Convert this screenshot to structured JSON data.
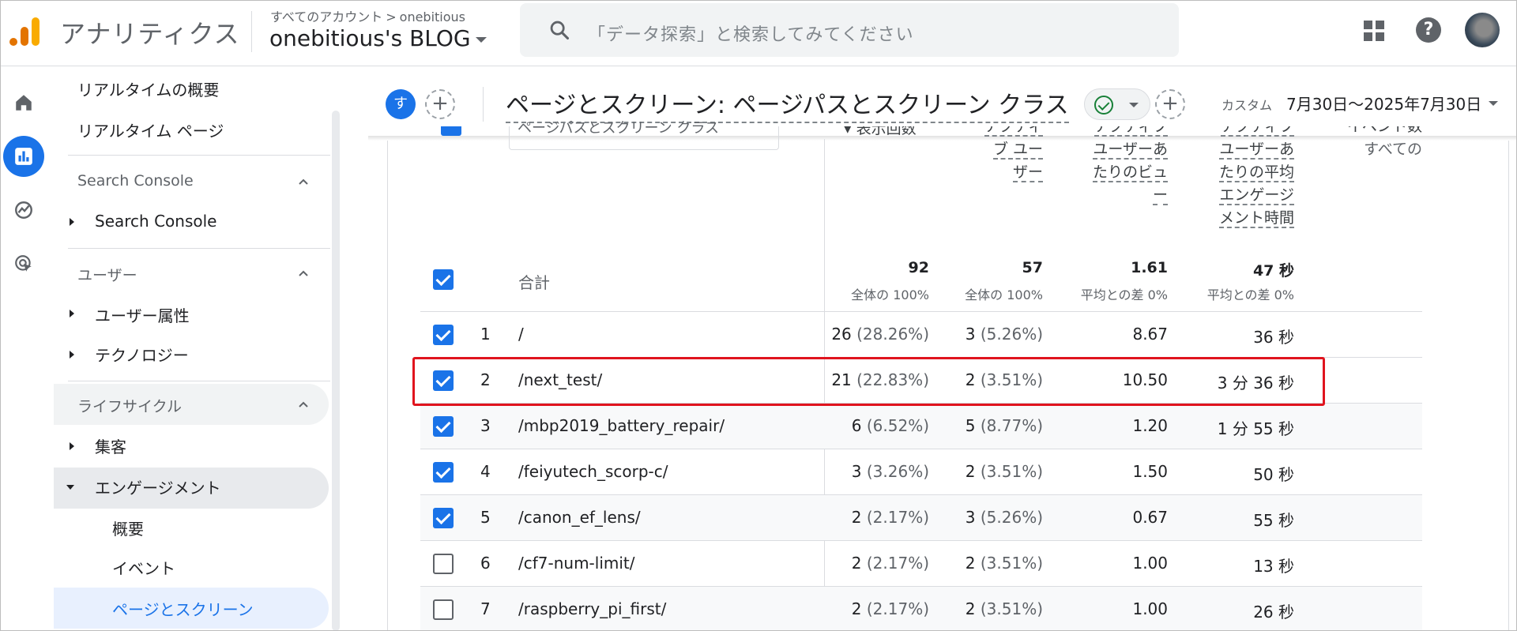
{
  "header": {
    "app_name": "アナリティクス",
    "crumb_root": "すべてのアカウント",
    "crumb_sep": ">",
    "crumb_account": "onebitious",
    "property": "onebitious's BLOG",
    "search_placeholder": "「データ探索」と検索してみてください",
    "help_glyph": "?"
  },
  "sidebar": {
    "items": [
      {
        "label": "リアルタイムの概要"
      },
      {
        "label": "リアルタイム ページ"
      }
    ],
    "sections": [
      {
        "title": "Search Console",
        "items": [
          "Search Console"
        ]
      },
      {
        "title": "ユーザー",
        "items": [
          "ユーザー属性",
          "テクノロジー"
        ]
      },
      {
        "title": "ライフサイクル",
        "items": [
          "集客",
          "エンゲージメント"
        ],
        "sub_items": [
          "概要",
          "イベント",
          "ページとスクリーン"
        ]
      }
    ]
  },
  "report": {
    "comparison_avatar": "す",
    "plus": "+",
    "title": "ページとスクリーン: ページパスとスクリーン クラス",
    "date_label": "カスタム",
    "date_range": "7月30日～2025年7月30日"
  },
  "table": {
    "header_partial": {
      "col1_top": "ページパスとスクリーン クラス",
      "col_views_top": "表示回数",
      "col_users": [
        "アクティ",
        "ブ ユー",
        "ザー"
      ],
      "col_views_per_user": [
        "アクティブ",
        "ユーザーあ",
        "たりのビュ",
        "ー"
      ],
      "col_avg_engagement": [
        "アクティブ",
        "ユーザーあ",
        "たりの平均",
        "エンゲージ",
        "メント時間"
      ],
      "col_events": [
        "イベント数",
        "すべての"
      ]
    },
    "total": {
      "label": "合計",
      "views": "92",
      "views_sub": "全体の 100%",
      "users": "57",
      "users_sub": "全体の 100%",
      "vpu": "1.61",
      "vpu_sub": "平均との差 0%",
      "eng": "47 秒",
      "eng_sub": "平均との差 0%"
    },
    "rows": [
      {
        "rank": "1",
        "path": "/",
        "views": "26",
        "views_pct": "(28.26%)",
        "users": "3",
        "users_pct": "(5.26%)",
        "vpu": "8.67",
        "eng": "36 秒",
        "checked": true
      },
      {
        "rank": "2",
        "path": "/next_test/",
        "views": "21",
        "views_pct": "(22.83%)",
        "users": "2",
        "users_pct": "(3.51%)",
        "vpu": "10.50",
        "eng": "3 分 36 秒",
        "checked": true
      },
      {
        "rank": "3",
        "path": "/mbp2019_battery_repair/",
        "views": "6",
        "views_pct": "(6.52%)",
        "users": "5",
        "users_pct": "(8.77%)",
        "vpu": "1.20",
        "eng": "1 分 55 秒",
        "checked": true
      },
      {
        "rank": "4",
        "path": "/feiyutech_scorp-c/",
        "views": "3",
        "views_pct": "(3.26%)",
        "users": "2",
        "users_pct": "(3.51%)",
        "vpu": "1.50",
        "eng": "50 秒",
        "checked": true
      },
      {
        "rank": "5",
        "path": "/canon_ef_lens/",
        "views": "2",
        "views_pct": "(2.17%)",
        "users": "3",
        "users_pct": "(5.26%)",
        "vpu": "0.67",
        "eng": "55 秒",
        "checked": true
      },
      {
        "rank": "6",
        "path": "/cf7-num-limit/",
        "views": "2",
        "views_pct": "(2.17%)",
        "users": "2",
        "users_pct": "(3.51%)",
        "vpu": "1.00",
        "eng": "13 秒",
        "checked": false
      },
      {
        "rank": "7",
        "path": "/raspberry_pi_first/",
        "views": "2",
        "views_pct": "(2.17%)",
        "users": "2",
        "users_pct": "(3.51%)",
        "vpu": "1.00",
        "eng": "26 秒",
        "checked": false
      }
    ]
  },
  "colors": {
    "accent": "#1a73e8",
    "highlight_box": "#e0141e",
    "success": "#188038",
    "logo_orange": "#f9ab00",
    "logo_dark": "#e37400"
  }
}
